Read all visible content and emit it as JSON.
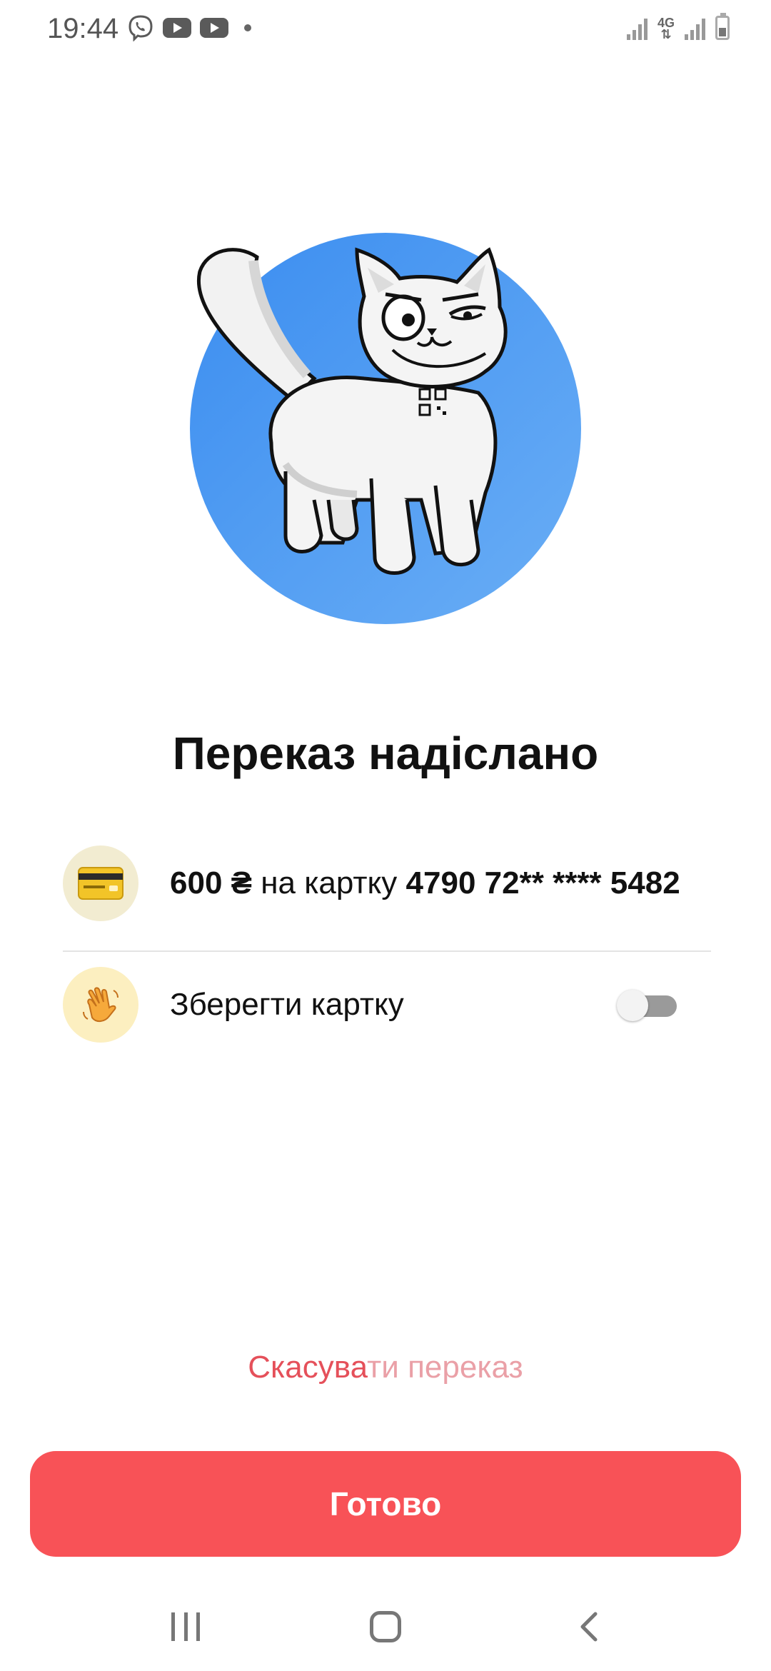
{
  "status_bar": {
    "time": "19:44",
    "left_icons": [
      "viber-icon",
      "youtube-icon",
      "youtube-icon",
      "notification-dot"
    ],
    "network": "4G"
  },
  "hero": {
    "image": "cat-mascot-illustration",
    "circle_color": "#4a97f0"
  },
  "title": "Переказ надіслано",
  "transfer": {
    "icon": "credit-card-icon",
    "amount": "600 ₴",
    "connector": "на картку",
    "card_number": "4790 72** **** 5482"
  },
  "save_card": {
    "icon": "waving-hand-icon",
    "label": "Зберегти картку",
    "enabled": false
  },
  "cancel": {
    "label_part1": "Скасува",
    "label_part2": "ти переказ",
    "color": "#e5505a"
  },
  "done_button": {
    "label": "Готово",
    "color": "#f85257"
  },
  "nav_bar": [
    "recents-icon",
    "home-icon",
    "back-icon"
  ]
}
